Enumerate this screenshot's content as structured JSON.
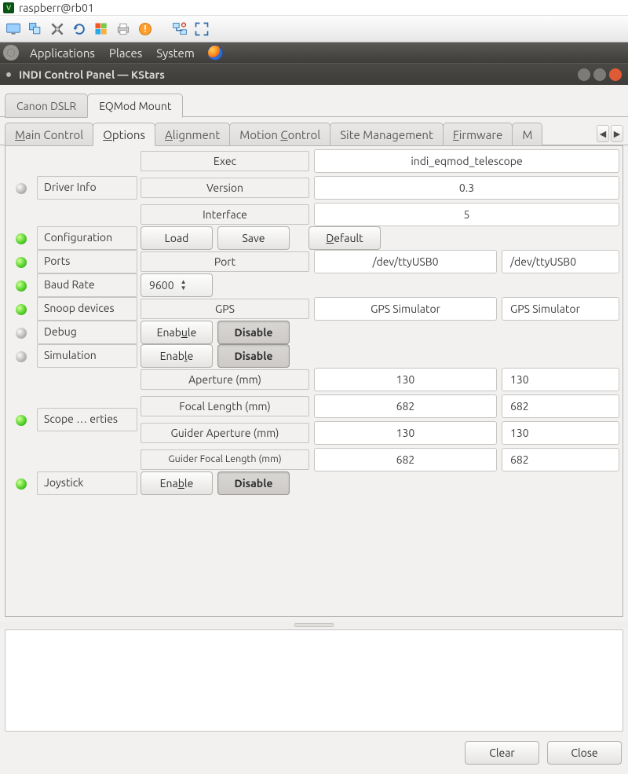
{
  "vnc": {
    "title": "raspberr@rb01"
  },
  "gnome": {
    "items": [
      "Applications",
      "Places",
      "System"
    ]
  },
  "window": {
    "title": "INDI Control Panel — KStars"
  },
  "device_tabs": [
    "Canon DSLR",
    "EQMod Mount"
  ],
  "device_tabs_active": 1,
  "section_tabs": [
    "Main Control",
    "Options",
    "Alignment",
    "Motion Control",
    "Site Management",
    "Firmware",
    "M"
  ],
  "section_tabs_active": 1,
  "section_tabs_mnemonic_idx": [
    0,
    0,
    0,
    7,
    -1,
    0,
    0
  ],
  "props": {
    "driver_info": {
      "label": "Driver Info",
      "led": "gray",
      "items": [
        {
          "name": "Exec",
          "value": "indi_eqmod_telescope"
        },
        {
          "name": "Version",
          "value": "0.3"
        },
        {
          "name": "Interface",
          "value": "5"
        }
      ]
    },
    "configuration": {
      "label": "Configuration",
      "led": "green",
      "buttons": {
        "load": "Load",
        "save": "Save",
        "default_": "Default",
        "default_mnem": "D"
      }
    },
    "ports": {
      "label": "Ports",
      "led": "green",
      "name": "Port",
      "value": "/dev/ttyUSB0",
      "edit": "/dev/ttyUSB0"
    },
    "baud": {
      "label": "Baud Rate",
      "led": "green",
      "value": "9600"
    },
    "snoop": {
      "label": "Snoop devices",
      "led": "green",
      "name": "GPS",
      "value": "GPS Simulator",
      "edit": "GPS Simulator"
    },
    "debug": {
      "label": "Debug",
      "led": "gray",
      "enable": "Enable",
      "disable": "Disable",
      "enable_mnem": "u"
    },
    "simulation": {
      "label": "Simulation",
      "led": "gray",
      "enable": "Enable",
      "disable": "Disable",
      "enable_mnem": "l"
    },
    "scope": {
      "label": "Scope … erties",
      "led": "green",
      "items": [
        {
          "name": "Aperture (mm)",
          "value": "130",
          "edit": "130"
        },
        {
          "name": "Focal Length (mm)",
          "value": "682",
          "edit": "682"
        },
        {
          "name": "Guider Aperture (mm)",
          "value": "130",
          "edit": "130"
        },
        {
          "name": "Guider Focal Length (mm)",
          "value": "682",
          "edit": "682"
        }
      ]
    },
    "joystick": {
      "label": "Joystick",
      "led": "green",
      "enable": "Enable",
      "disable": "Disable",
      "enable_mnem": "b"
    }
  },
  "footer": {
    "clear": "Clear",
    "close": "Close"
  }
}
